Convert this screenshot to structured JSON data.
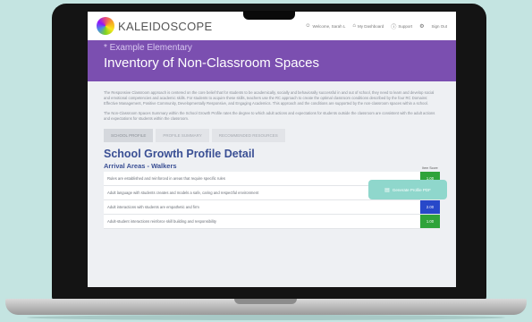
{
  "header": {
    "brand": "KALEIDOSCOPE",
    "welcome": "Welcome, Sarah L",
    "dashboard": "My Dashboard",
    "support": "Support",
    "signout": "Sign Out"
  },
  "banner": {
    "school": "* Example Elementary",
    "title": "Inventory of Non-Classroom Spaces"
  },
  "intro": {
    "p1": "The Responsive Classroom approach is centered on the core belief that for students to be academically, socially and behaviorally successful in and out of school, they need to learn and develop social and emotional competencies and academic skills. For students to acquire these skills, teachers use the RC approach to create the optimal classroom conditions described by the four RC Domains: Effective Management, Positive Community, Developmentally Responsive, and Engaging Academics. This approach and the conditions are supported by the non-classroom spaces within a school.",
    "p2": "The Non-Classroom Spaces Summary within the School Growth Profile rates the degree to which adult actions and expectations for students outside the classroom are consistent with the adult actions and expectations for students within the classroom."
  },
  "tabs": [
    {
      "label": "SCHOOL PROFILE"
    },
    {
      "label": "PROFILE SUMMARY"
    },
    {
      "label": "RECOMMENDED RESOURCES"
    }
  ],
  "generate_button": "Generate Profile PDF",
  "detail": {
    "title": "School Growth Profile Detail",
    "section": "Arrival Areas - Walkers",
    "score_header": "Item Score"
  },
  "rows": [
    {
      "text": "Rules are established and reinforced in areas that require specific rules",
      "score": "1.00",
      "color": "#2fa33a"
    },
    {
      "text": "Adult language with students creates and models a safe, caring and respectful environment",
      "score": "2.00",
      "color": "#2748c9"
    },
    {
      "text": "Adult interactions with students are empathetic and firm",
      "score": "2.00",
      "color": "#2748c9"
    },
    {
      "text": "Adult-student interactions reinforce skill building and responsibility",
      "score": "1.00",
      "color": "#2fa33a"
    }
  ],
  "icons": {
    "welcome": "user-icon",
    "dashboard": "home-icon",
    "support": "help-icon",
    "settings": "gear-icon",
    "generate": "document-icon"
  }
}
